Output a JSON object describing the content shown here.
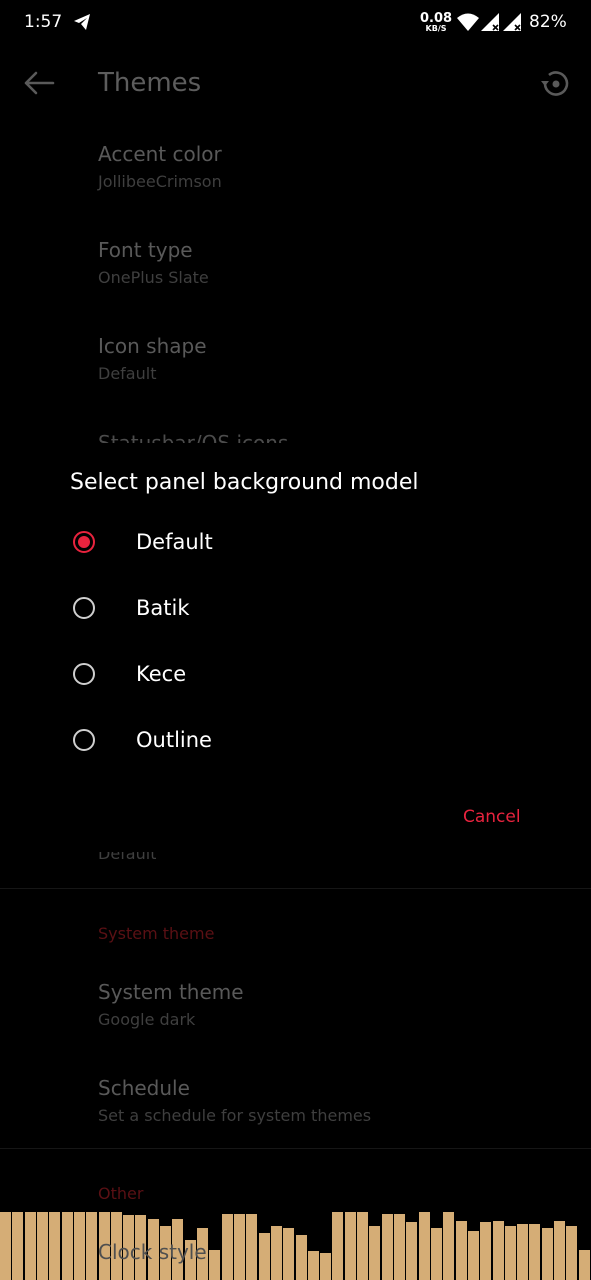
{
  "status_bar": {
    "time": "1:57",
    "net_speed": "0.08",
    "net_unit": "KB/S",
    "battery": "82%",
    "icons": [
      "telegram-icon",
      "wifi-icon",
      "signal-icon",
      "signal-icon"
    ]
  },
  "app_bar": {
    "title": "Themes",
    "back_icon": "arrow-left-icon",
    "reset_icon": "history-reset-icon"
  },
  "settings": {
    "accent": {
      "title": "Accent color",
      "value": "JollibeeCrimson"
    },
    "font": {
      "title": "Font type",
      "value": "OnePlus Slate"
    },
    "icon_shape": {
      "title": "Icon shape",
      "value": "Default"
    },
    "statusbar_partial": "Statusbar/QS icons",
    "partial_value_below_dialog": "Default",
    "system_theme_header": "System theme",
    "system_theme": {
      "title": "System theme",
      "value": "Google dark"
    },
    "schedule": {
      "title": "Schedule",
      "value": "Set a schedule for system themes"
    },
    "other_header": "Other",
    "clock_style": "Clock style"
  },
  "dialog": {
    "title": "Select panel background model",
    "options": [
      {
        "label": "Default",
        "selected": true
      },
      {
        "label": "Batik",
        "selected": false
      },
      {
        "label": "Kece",
        "selected": false
      },
      {
        "label": "Outline",
        "selected": false
      }
    ],
    "cancel_label": "Cancel"
  },
  "music_visualizer": {
    "color": "#d5ad76",
    "levels": [
      0.95,
      0.95,
      0.95,
      0.95,
      0.95,
      0.95,
      0.95,
      0.95,
      0.95,
      0.95,
      0.9,
      0.9,
      0.85,
      0.75,
      0.85,
      0.55,
      0.72,
      0.42,
      0.92,
      0.92,
      0.92,
      0.65,
      0.75,
      0.72,
      0.62,
      0.4,
      0.38,
      0.95,
      0.95,
      0.95,
      0.75,
      0.92,
      0.92,
      0.8,
      0.95,
      0.72,
      0.95,
      0.82,
      0.68,
      0.8,
      0.82,
      0.75,
      0.78,
      0.78,
      0.72,
      0.82,
      0.75,
      0.42
    ]
  },
  "colors": {
    "accent": "#e8233e",
    "section_header": "#5a1014",
    "background": "#000000"
  }
}
